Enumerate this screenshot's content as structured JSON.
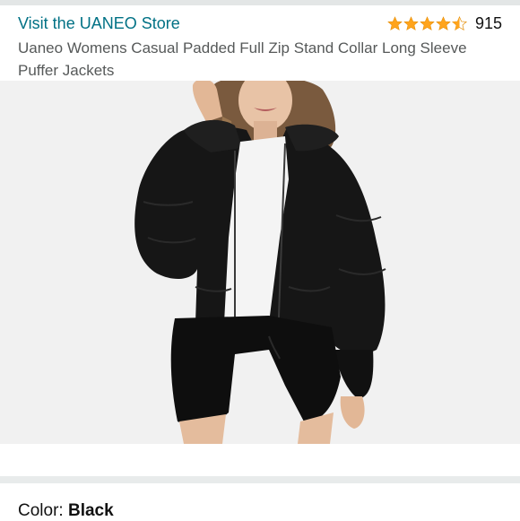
{
  "header": {
    "store_link": "Visit the UANEO Store",
    "rating_value": 4.5,
    "rating_count": "915",
    "star_color": "#FFA41C"
  },
  "product": {
    "title": "Uaneo Womens Casual Padded Full Zip Stand Collar Long Sleeve Puffer Jackets",
    "image_icon": "product-photo-puffer-jacket"
  },
  "color": {
    "label": "Color: ",
    "value": "Black"
  }
}
